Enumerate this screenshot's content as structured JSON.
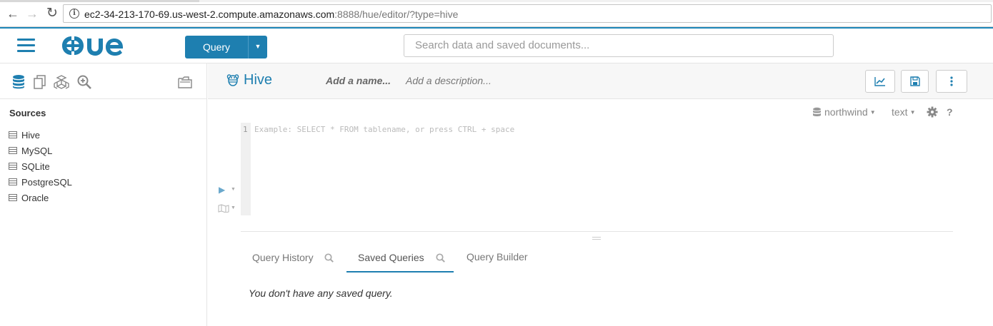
{
  "browser": {
    "url_host": "ec2-34-213-170-69.us-west-2.compute.amazonaws.com",
    "url_path": ":8888/hue/editor/?type=hive"
  },
  "topbar": {
    "query_label": "Query",
    "search_placeholder": "Search data and saved documents...",
    "accent_color": "#1e7fb0"
  },
  "left": {
    "sources_title": "Sources",
    "sources": [
      "Hive",
      "MySQL",
      "SQLite",
      "PostgreSQL",
      "Oracle"
    ]
  },
  "editor": {
    "title": "Hive",
    "name_placeholder": "Add a name...",
    "description_placeholder": "Add a description...",
    "database": "northwind",
    "format": "text",
    "help": "?",
    "line_number": "1",
    "placeholder": "Example: SELECT * FROM tablename, or press CTRL + space"
  },
  "bottom": {
    "tabs": [
      "Query History",
      "Saved Queries",
      "Query Builder"
    ],
    "active_tab": "Saved Queries",
    "empty_message": "You don't have any saved query."
  }
}
